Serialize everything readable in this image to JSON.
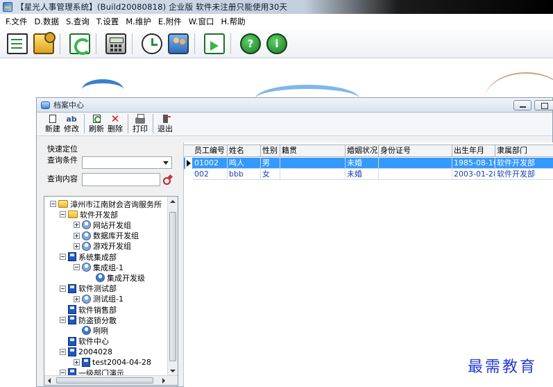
{
  "window": {
    "title": "【星光人事管理系统】(Build20080818) 企业版 软件未注册只能使用30天"
  },
  "menu": [
    {
      "id": "file",
      "label": "F.文件"
    },
    {
      "id": "data",
      "label": "D.数据"
    },
    {
      "id": "query",
      "label": "S.查询"
    },
    {
      "id": "settings",
      "label": "T.设置"
    },
    {
      "id": "maintain",
      "label": "M.维护"
    },
    {
      "id": "attach",
      "label": "E.附件"
    },
    {
      "id": "window",
      "label": "W.窗口"
    },
    {
      "id": "help",
      "label": "H.帮助"
    }
  ],
  "toolbar_icons": [
    "document-icon",
    "folder-gear-icon",
    "refresh-icon",
    "calculator-icon",
    "clock-icon",
    "people-icon",
    "export-icon",
    "help-icon",
    "info-icon"
  ],
  "toolbar_glyphs": {
    "help": "?",
    "info": "i"
  },
  "child_window": {
    "title": "档案中心",
    "toolbar": {
      "new": "新建",
      "edit": "修改",
      "edit_glyph": "ab",
      "refresh": "刷新",
      "delete": "删除",
      "delete_glyph": "✕",
      "print": "打印",
      "exit": "退出"
    },
    "search": {
      "section_label": "快速定位",
      "condition_label": "查询条件",
      "condition_value": "",
      "content_label": "查询内容",
      "content_value": ""
    },
    "tree": [
      {
        "label": "漳州市江南财会咨询服务所",
        "icon": "folder",
        "level": 0,
        "expander": "minus"
      },
      {
        "label": "软件开发部",
        "icon": "folder",
        "level": 1,
        "expander": "minus"
      },
      {
        "label": "网站开发组",
        "icon": "group",
        "level": 2,
        "expander": "plus"
      },
      {
        "label": "数据库开发组",
        "icon": "group",
        "level": 2,
        "expander": "plus"
      },
      {
        "label": "游戏开发组",
        "icon": "group",
        "level": 2,
        "expander": "plus"
      },
      {
        "label": "系统集成部",
        "icon": "disk",
        "level": 1,
        "expander": "minus"
      },
      {
        "label": "集成组-1",
        "icon": "group",
        "level": 2,
        "expander": "minus"
      },
      {
        "label": "集成开发级",
        "icon": "group-blue",
        "level": 3,
        "expander": "none"
      },
      {
        "label": "软件测试部",
        "icon": "disk",
        "level": 1,
        "expander": "minus"
      },
      {
        "label": "测试组-1",
        "icon": "group",
        "level": 2,
        "expander": "plus"
      },
      {
        "label": "软件销售部",
        "icon": "disk",
        "level": 1,
        "expander": "none"
      },
      {
        "label": "防盗锁分散",
        "icon": "disk",
        "level": 1,
        "expander": "minus"
      },
      {
        "label": "咧咧",
        "icon": "group-blue",
        "level": 2,
        "expander": "none"
      },
      {
        "label": "软件中心",
        "icon": "disk",
        "level": 1,
        "expander": "none"
      },
      {
        "label": "2004028",
        "icon": "disk",
        "level": 1,
        "expander": "minus"
      },
      {
        "label": "test2004-04-28",
        "icon": "disk",
        "level": 2,
        "expander": "plus"
      },
      {
        "label": "一级部门演示",
        "icon": "disk",
        "level": 1,
        "expander": "minus"
      }
    ],
    "grid": {
      "columns": [
        "员工编号",
        "姓名",
        "性别",
        "籍贯",
        "婚姻状况",
        "身份证号",
        "出生年月",
        "隶属部门"
      ],
      "rows": [
        {
          "selected": true,
          "cells": [
            "01002",
            "鸣人",
            "男",
            "",
            "未婚",
            "",
            "1985-08-10",
            "软件开发部"
          ]
        },
        {
          "selected": false,
          "cells": [
            "002",
            "bbb",
            "女",
            "",
            "未婚",
            "",
            "2003-01-28",
            "软件开发部"
          ]
        }
      ]
    }
  },
  "watermark": "最需教育",
  "colors": {
    "selection": "#3399ff",
    "grid_text": "#1a3fa8",
    "watermark": "#2a3bd0"
  }
}
